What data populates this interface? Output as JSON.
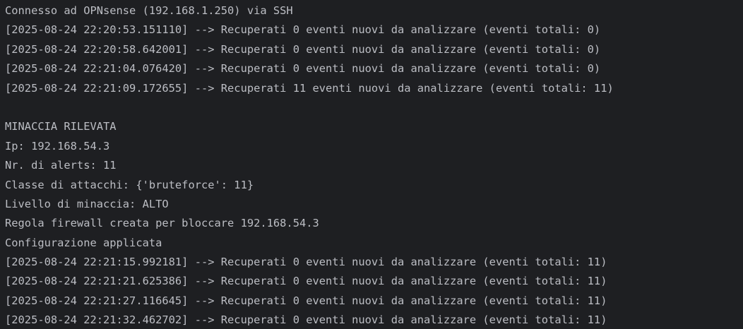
{
  "terminal": {
    "lines": [
      "Connesso ad OPNsense (192.168.1.250) via SSH",
      "[2025-08-24 22:20:53.151110] --> Recuperati 0 eventi nuovi da analizzare (eventi totali: 0)",
      "[2025-08-24 22:20:58.642001] --> Recuperati 0 eventi nuovi da analizzare (eventi totali: 0)",
      "[2025-08-24 22:21:04.076420] --> Recuperati 0 eventi nuovi da analizzare (eventi totali: 0)",
      "[2025-08-24 22:21:09.172655] --> Recuperati 11 eventi nuovi da analizzare (eventi totali: 11)",
      "",
      "MINACCIA RILEVATA",
      "Ip: 192.168.54.3",
      "Nr. di alerts: 11",
      "Classe di attacchi: {'bruteforce': 11}",
      "Livello di minaccia: ALTO",
      "Regola firewall creata per bloccare 192.168.54.3",
      "Configurazione applicata",
      "[2025-08-24 22:21:15.992181] --> Recuperati 0 eventi nuovi da analizzare (eventi totali: 11)",
      "[2025-08-24 22:21:21.625386] --> Recuperati 0 eventi nuovi da analizzare (eventi totali: 11)",
      "[2025-08-24 22:21:27.116645] --> Recuperati 0 eventi nuovi da analizzare (eventi totali: 11)",
      "[2025-08-24 22:21:32.462702] --> Recuperati 0 eventi nuovi da analizzare (eventi totali: 11)"
    ]
  }
}
